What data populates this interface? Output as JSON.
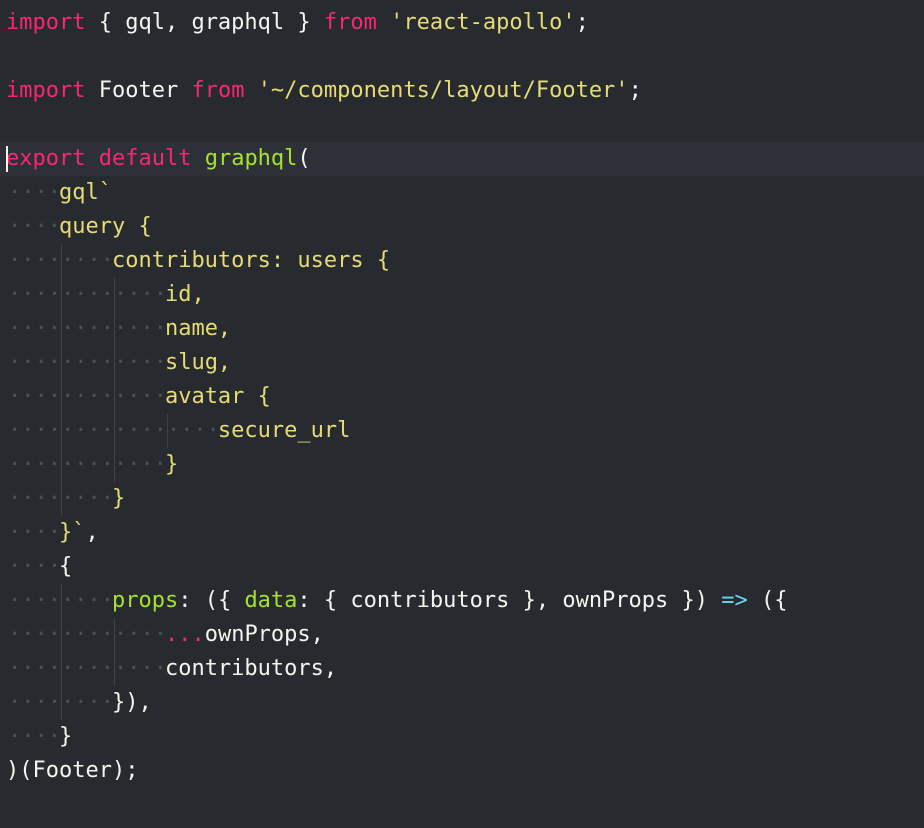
{
  "editor": {
    "lines": [
      [
        {
          "t": "import",
          "c": "kw"
        },
        {
          "t": " { gql, graphql } ",
          "c": "pl"
        },
        {
          "t": "from",
          "c": "kw"
        },
        {
          "t": " ",
          "c": "pl"
        },
        {
          "t": "'react-apollo'",
          "c": "str"
        },
        {
          "t": ";",
          "c": "pl"
        }
      ],
      [],
      [
        {
          "t": "import",
          "c": "kw"
        },
        {
          "t": " Footer ",
          "c": "pl"
        },
        {
          "t": "from",
          "c": "kw"
        },
        {
          "t": " ",
          "c": "pl"
        },
        {
          "t": "'~/components/layout/Footer'",
          "c": "str"
        },
        {
          "t": ";",
          "c": "pl"
        }
      ],
      [],
      [
        {
          "t": "export",
          "c": "kw"
        },
        {
          "t": " ",
          "c": "pl"
        },
        {
          "t": "default",
          "c": "kw"
        },
        {
          "t": " ",
          "c": "pl"
        },
        {
          "t": "graphql",
          "c": "fn"
        },
        {
          "t": "(",
          "c": "pl"
        }
      ],
      [
        {
          "t": "    ",
          "c": "pl"
        },
        {
          "t": "gql`",
          "c": "gql"
        }
      ],
      [
        {
          "t": "    ",
          "c": "pl"
        },
        {
          "t": "query {",
          "c": "gql"
        }
      ],
      [
        {
          "t": "        ",
          "c": "pl"
        },
        {
          "t": "contributors: users {",
          "c": "gql"
        }
      ],
      [
        {
          "t": "            ",
          "c": "pl"
        },
        {
          "t": "id,",
          "c": "gql"
        }
      ],
      [
        {
          "t": "            ",
          "c": "pl"
        },
        {
          "t": "name,",
          "c": "gql"
        }
      ],
      [
        {
          "t": "            ",
          "c": "pl"
        },
        {
          "t": "slug,",
          "c": "gql"
        }
      ],
      [
        {
          "t": "            ",
          "c": "pl"
        },
        {
          "t": "avatar {",
          "c": "gql"
        }
      ],
      [
        {
          "t": "                ",
          "c": "pl"
        },
        {
          "t": "secure_url",
          "c": "gql"
        }
      ],
      [
        {
          "t": "            ",
          "c": "pl"
        },
        {
          "t": "}",
          "c": "gql"
        }
      ],
      [
        {
          "t": "        ",
          "c": "pl"
        },
        {
          "t": "}",
          "c": "gql"
        }
      ],
      [
        {
          "t": "    ",
          "c": "pl"
        },
        {
          "t": "}`",
          "c": "gql"
        },
        {
          "t": ",",
          "c": "pl"
        }
      ],
      [
        {
          "t": "    ",
          "c": "pl"
        },
        {
          "t": "{",
          "c": "pl"
        }
      ],
      [
        {
          "t": "        ",
          "c": "pl"
        },
        {
          "t": "props",
          "c": "fn"
        },
        {
          "t": ": ({ ",
          "c": "pl"
        },
        {
          "t": "data",
          "c": "fn"
        },
        {
          "t": ": { contributors }, ownProps }) ",
          "c": "pl"
        },
        {
          "t": "=>",
          "c": "op"
        },
        {
          "t": " ({",
          "c": "pl"
        }
      ],
      [
        {
          "t": "            ",
          "c": "pl"
        },
        {
          "t": "...",
          "c": "spread"
        },
        {
          "t": "ownProps,",
          "c": "pl"
        }
      ],
      [
        {
          "t": "            ",
          "c": "pl"
        },
        {
          "t": "contributors,",
          "c": "pl"
        }
      ],
      [
        {
          "t": "        ",
          "c": "pl"
        },
        {
          "t": "}),",
          "c": "pl"
        }
      ],
      [
        {
          "t": "    ",
          "c": "pl"
        },
        {
          "t": "}",
          "c": "pl"
        }
      ],
      [
        {
          "t": ")(Footer);",
          "c": "pl"
        }
      ]
    ],
    "current_line": 4,
    "colors": {
      "background": "#272a2f",
      "keyword": "#f92672",
      "function": "#a6e22e",
      "string": "#e6db74",
      "plain": "#f5f5ef",
      "operator": "#66d9ef"
    }
  }
}
